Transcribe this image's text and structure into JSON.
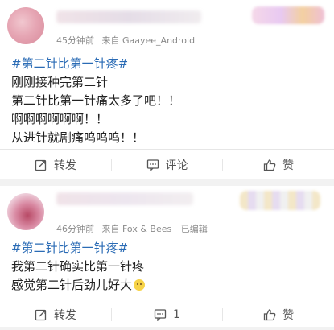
{
  "posts": [
    {
      "time": "45分钟前",
      "source_prefix": "来自",
      "source": "Gaayee_Android",
      "edited": "",
      "tag": "#第二针比第一针疼#",
      "lines": [
        "刚刚接种完第二针",
        "第二针比第一针痛太多了吧！！",
        "啊啊啊啊啊啊！！",
        "从进针就剧痛呜呜呜！！"
      ],
      "actions": {
        "repost": "转发",
        "comment": "评论",
        "like": "赞"
      }
    },
    {
      "time": "46分钟前",
      "source_prefix": "来自",
      "source": "Fox & Bees",
      "edited": "已编辑",
      "tag": "#第二针比第一针疼#",
      "lines": [
        "我第二针确实比第一针疼",
        "感觉第二针后劲儿好大"
      ],
      "actions": {
        "repost": "转发",
        "comment": "1",
        "like": "赞"
      }
    }
  ],
  "icons": {
    "repost": "repost-icon",
    "comment": "comment-icon",
    "like": "thumbs-up-icon",
    "emoji": "grin-emoji-icon"
  },
  "colors": {
    "tag": "#2a6bb5",
    "meta": "#8a8a8a",
    "background": "#f2f2f2"
  }
}
